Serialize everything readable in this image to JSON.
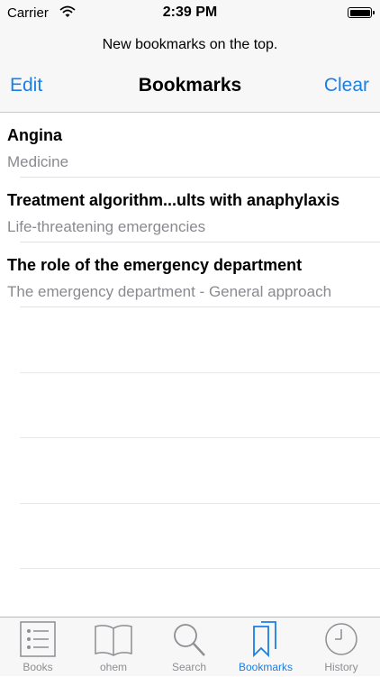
{
  "status_bar": {
    "carrier": "Carrier",
    "time": "2:39 PM"
  },
  "header": {
    "prompt": "New bookmarks on the top.",
    "edit_label": "Edit",
    "title": "Bookmarks",
    "clear_label": "Clear"
  },
  "bookmarks": [
    {
      "title": "Angina",
      "subtitle": "Medicine"
    },
    {
      "title": "Treatment algorithm...ults with anaphylaxis",
      "subtitle": "Life-threatening emergencies"
    },
    {
      "title": "The role of the emergency department",
      "subtitle": "The emergency department - General approach"
    }
  ],
  "tabs": [
    {
      "label": "Books",
      "icon": "list-icon"
    },
    {
      "label": "ohem",
      "icon": "book-icon"
    },
    {
      "label": "Search",
      "icon": "search-icon"
    },
    {
      "label": "Bookmarks",
      "icon": "bookmarks-icon",
      "active": true
    },
    {
      "label": "History",
      "icon": "clock-icon"
    }
  ],
  "colors": {
    "accent": "#1b7fe3",
    "inactive": "#8e8e93",
    "bar_bg": "#f7f7f7"
  }
}
